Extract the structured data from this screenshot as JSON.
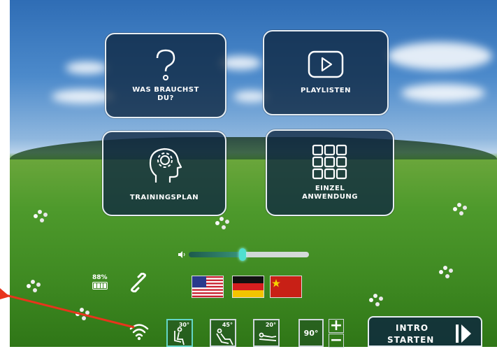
{
  "tiles": {
    "was_brauchst_du": {
      "label_line1": "WAS BRAUCHST",
      "label_line2": "DU?"
    },
    "playlisten": {
      "label": "PLAYLISTEN"
    },
    "trainingsplan": {
      "label": "TRAININGSPLAN"
    },
    "einzel_anwendung": {
      "label_line1": "EINZEL",
      "label_line2": "ANWENDUNG"
    }
  },
  "status": {
    "battery_percent": "88%",
    "volume_level": 0.45
  },
  "languages": [
    "USA",
    "Germany",
    "China"
  ],
  "seat_positions": [
    {
      "angle": "30°",
      "selected": true
    },
    {
      "angle": "45°",
      "selected": false
    },
    {
      "angle": "20°",
      "selected": false
    }
  ],
  "angle_display": "90°",
  "intro_button": {
    "line1": "INTRO",
    "line2": "STARTEN"
  },
  "colors": {
    "accent": "#4fe0d0",
    "tile_bg": "#0e2640",
    "pointer": "#e8341c"
  }
}
